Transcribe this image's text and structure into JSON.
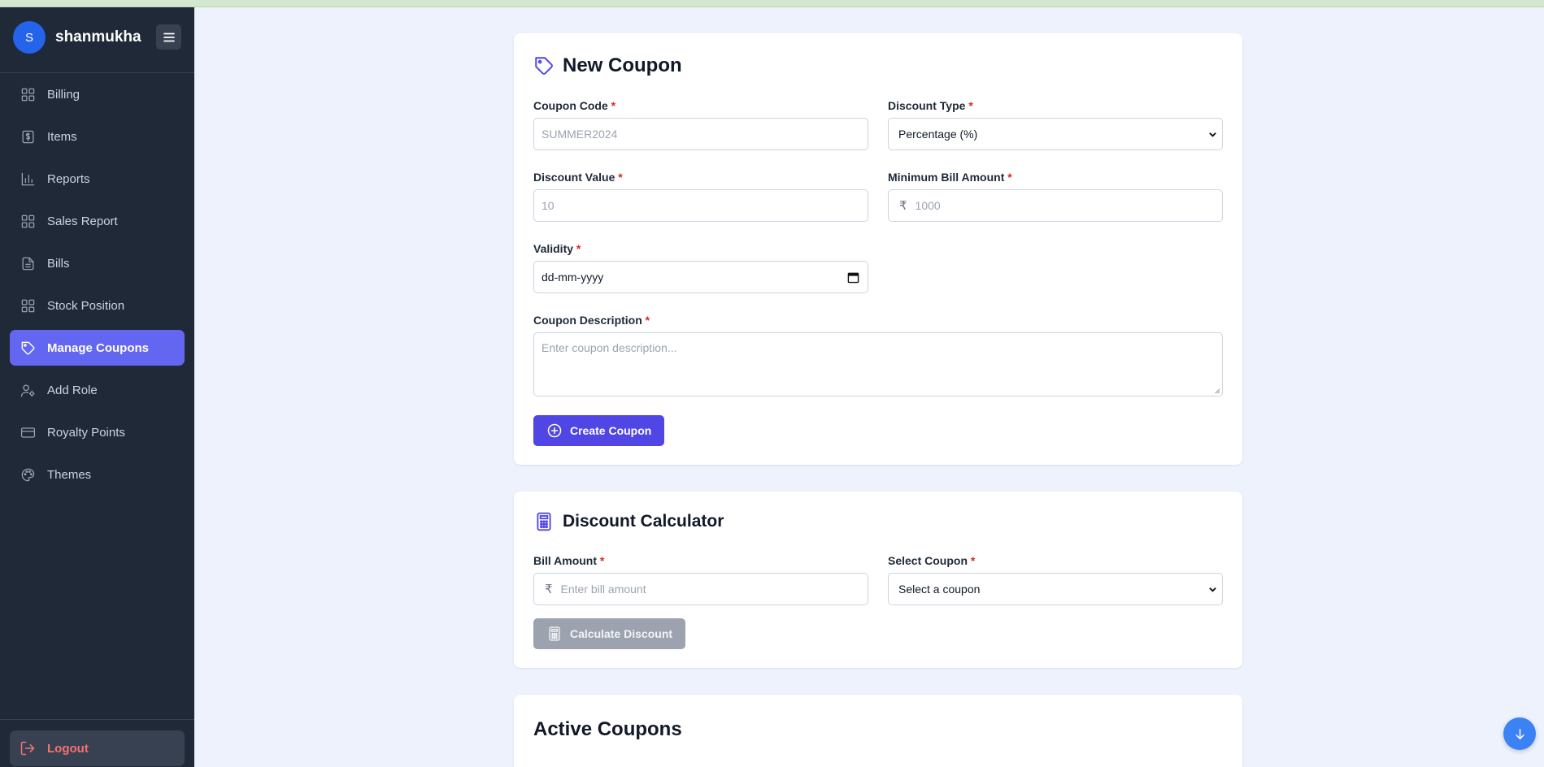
{
  "sidebar": {
    "avatar_letter": "S",
    "username": "shanmukha",
    "items": [
      {
        "label": "Billing",
        "icon": "grid-icon"
      },
      {
        "label": "Items",
        "icon": "dollar-file-icon"
      },
      {
        "label": "Reports",
        "icon": "bar-chart-icon"
      },
      {
        "label": "Sales Report",
        "icon": "grid-icon"
      },
      {
        "label": "Bills",
        "icon": "file-text-icon"
      },
      {
        "label": "Stock Position",
        "icon": "grid-icon"
      },
      {
        "label": "Manage Coupons",
        "icon": "tag-icon",
        "active": true
      },
      {
        "label": "Add Role",
        "icon": "user-gear-icon"
      },
      {
        "label": "Royalty Points",
        "icon": "credit-card-icon"
      },
      {
        "label": "Themes",
        "icon": "palette-icon"
      }
    ],
    "logout_label": "Logout"
  },
  "new_coupon": {
    "title": "New Coupon",
    "coupon_code_label": "Coupon Code",
    "coupon_code_placeholder": "SUMMER2024",
    "discount_type_label": "Discount Type",
    "discount_type_value": "Percentage (%)",
    "discount_value_label": "Discount Value",
    "discount_value_placeholder": "10",
    "min_bill_label": "Minimum Bill Amount",
    "min_bill_placeholder": "1000",
    "currency_symbol": "₹",
    "validity_label": "Validity",
    "validity_placeholder": "dd-mm-yyyy",
    "description_label": "Coupon Description",
    "description_placeholder": "Enter coupon description...",
    "required_mark": "*",
    "create_button": "Create Coupon"
  },
  "calculator": {
    "title": "Discount Calculator",
    "bill_amount_label": "Bill Amount",
    "bill_amount_placeholder": "Enter bill amount",
    "select_coupon_label": "Select Coupon",
    "select_coupon_value": "Select a coupon",
    "calculate_button": "Calculate Discount"
  },
  "active_coupons": {
    "title": "Active Coupons"
  },
  "colors": {
    "sidebar_bg": "#1f2937",
    "accent": "#6366f1",
    "primary_button": "#4f46e5",
    "logout_text": "#f87171",
    "page_bg": "#eef2fd"
  }
}
